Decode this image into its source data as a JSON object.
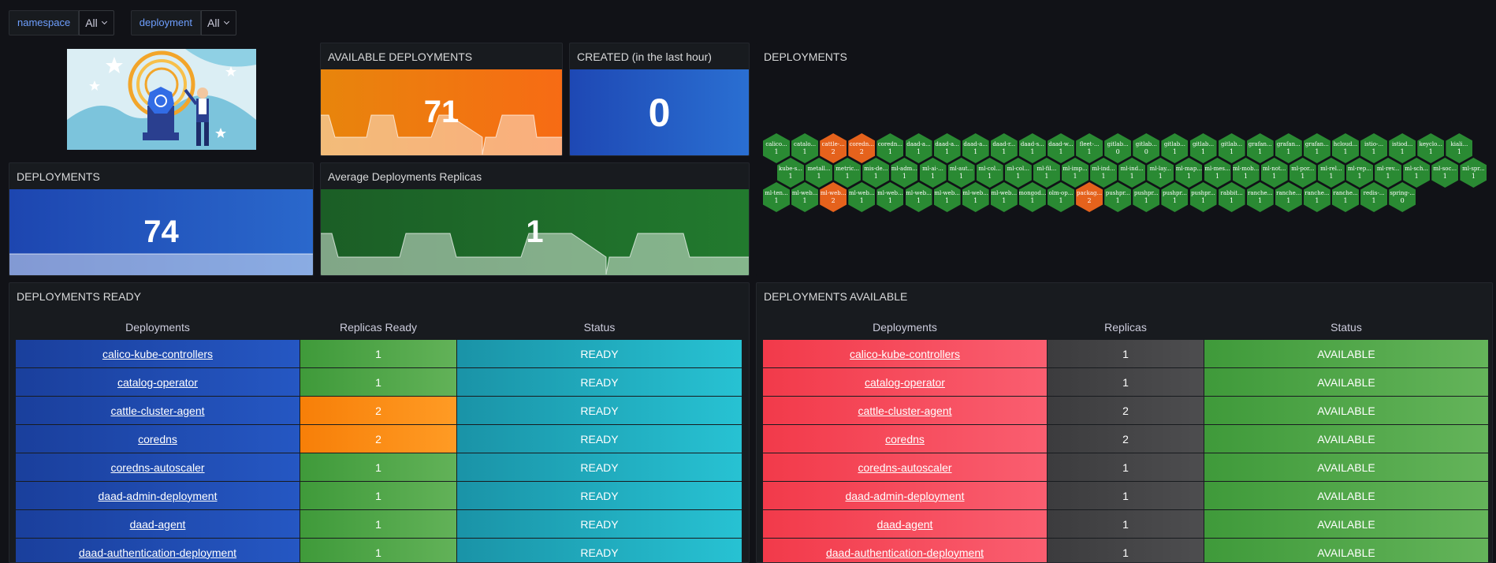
{
  "variables": [
    {
      "label": "namespace",
      "value": "All"
    },
    {
      "label": "deployment",
      "value": "All"
    }
  ],
  "panels": {
    "available_deployments": {
      "title": "AVAILABLE DEPLOYMENTS",
      "value": "71"
    },
    "created_last_hour": {
      "title": "CREATED (in the last hour)",
      "value": "0"
    },
    "deployments_count": {
      "title": "DEPLOYMENTS",
      "value": "74"
    },
    "avg_replicas": {
      "title": "Average Deployments Replicas",
      "value": "1"
    },
    "hex_panel": {
      "title": "DEPLOYMENTS"
    }
  },
  "colors": {
    "orange": "#f57110",
    "blue": "#1f5fc6",
    "green": "#1d7a2b",
    "hex_green": "#2a8a33",
    "hex_orange": "#e5621c",
    "ready_green": "#56a64b",
    "ready_orange": "#ff8c10",
    "status_teal": "#21a7b8",
    "red": "#f2495c",
    "gray": "#4a4a4c"
  },
  "hexagons": {
    "row1": [
      {
        "name": "calico...",
        "value": "1"
      },
      {
        "name": "catalo...",
        "value": "1"
      },
      {
        "name": "cattle-...",
        "value": "2"
      },
      {
        "name": "coredn...",
        "value": "2"
      },
      {
        "name": "coredn...",
        "value": "1"
      },
      {
        "name": "daad-a...",
        "value": "1"
      },
      {
        "name": "daad-a...",
        "value": "1"
      },
      {
        "name": "daad-a...",
        "value": "1"
      },
      {
        "name": "daad-r...",
        "value": "1"
      },
      {
        "name": "daad-s...",
        "value": "1"
      },
      {
        "name": "daad-w...",
        "value": "1"
      },
      {
        "name": "fleet-...",
        "value": "1"
      },
      {
        "name": "gitlab...",
        "value": "0"
      },
      {
        "name": "gitlab...",
        "value": "0"
      },
      {
        "name": "gitlab...",
        "value": "1"
      },
      {
        "name": "gitlab...",
        "value": "1"
      },
      {
        "name": "gitlab...",
        "value": "1"
      },
      {
        "name": "grafan...",
        "value": "1"
      },
      {
        "name": "grafan...",
        "value": "1"
      },
      {
        "name": "grafan...",
        "value": "1"
      },
      {
        "name": "hcloud...",
        "value": "1"
      },
      {
        "name": "istio-...",
        "value": "1"
      },
      {
        "name": "istiod...",
        "value": "1"
      },
      {
        "name": "keyclo...",
        "value": "1"
      },
      {
        "name": "kiali...",
        "value": "1"
      }
    ],
    "row2": [
      {
        "name": "kube-s...",
        "value": "1"
      },
      {
        "name": "metall...",
        "value": "1"
      },
      {
        "name": "metric...",
        "value": "1"
      },
      {
        "name": "mis-de...",
        "value": "1"
      },
      {
        "name": "ml-adm...",
        "value": "1"
      },
      {
        "name": "ml-ai-...",
        "value": "1"
      },
      {
        "name": "ml-aut...",
        "value": "1"
      },
      {
        "name": "ml-col...",
        "value": "1"
      },
      {
        "name": "ml-col...",
        "value": "1"
      },
      {
        "name": "ml-fil...",
        "value": "1"
      },
      {
        "name": "ml-imp...",
        "value": "1"
      },
      {
        "name": "ml-ind...",
        "value": "1"
      },
      {
        "name": "ml-ind...",
        "value": "1"
      },
      {
        "name": "ml-lay...",
        "value": "1"
      },
      {
        "name": "ml-map...",
        "value": "1"
      },
      {
        "name": "ml-mes...",
        "value": "1"
      },
      {
        "name": "ml-mob...",
        "value": "1"
      },
      {
        "name": "ml-not...",
        "value": "1"
      },
      {
        "name": "ml-por...",
        "value": "1"
      },
      {
        "name": "ml-rel...",
        "value": "1"
      },
      {
        "name": "ml-rep...",
        "value": "1"
      },
      {
        "name": "ml-rev...",
        "value": "1"
      },
      {
        "name": "ml-sch...",
        "value": "1"
      },
      {
        "name": "ml-soc...",
        "value": "1"
      },
      {
        "name": "ml-spr...",
        "value": "1"
      }
    ],
    "row3": [
      {
        "name": "ml-ten...",
        "value": "1"
      },
      {
        "name": "ml-web...",
        "value": "1"
      },
      {
        "name": "ml-web...",
        "value": "2"
      },
      {
        "name": "ml-web...",
        "value": "1"
      },
      {
        "name": "ml-web...",
        "value": "1"
      },
      {
        "name": "ml-web...",
        "value": "1"
      },
      {
        "name": "ml-web...",
        "value": "1"
      },
      {
        "name": "ml-web...",
        "value": "1"
      },
      {
        "name": "ml-web...",
        "value": "1"
      },
      {
        "name": "mongod...",
        "value": "1"
      },
      {
        "name": "olm-op...",
        "value": "1"
      },
      {
        "name": "packag...",
        "value": "2"
      },
      {
        "name": "pushpr...",
        "value": "1"
      },
      {
        "name": "pushpr...",
        "value": "1"
      },
      {
        "name": "pushpr...",
        "value": "1"
      },
      {
        "name": "pushpr...",
        "value": "1"
      },
      {
        "name": "rabbit...",
        "value": "1"
      },
      {
        "name": "ranche...",
        "value": "1"
      },
      {
        "name": "ranche...",
        "value": "1"
      },
      {
        "name": "ranche...",
        "value": "1"
      },
      {
        "name": "ranche...",
        "value": "1"
      },
      {
        "name": "redis-...",
        "value": "1"
      },
      {
        "name": "spring-...",
        "value": "0"
      }
    ]
  },
  "ready_table": {
    "title": "DEPLOYMENTS READY",
    "headers": [
      "Deployments",
      "Replicas Ready",
      "Status"
    ],
    "rows": [
      {
        "name": "calico-kube-controllers",
        "replicas": "1",
        "status": "READY"
      },
      {
        "name": "catalog-operator",
        "replicas": "1",
        "status": "READY"
      },
      {
        "name": "cattle-cluster-agent",
        "replicas": "2",
        "status": "READY"
      },
      {
        "name": "coredns",
        "replicas": "2",
        "status": "READY"
      },
      {
        "name": "coredns-autoscaler",
        "replicas": "1",
        "status": "READY"
      },
      {
        "name": "daad-admin-deployment",
        "replicas": "1",
        "status": "READY"
      },
      {
        "name": "daad-agent",
        "replicas": "1",
        "status": "READY"
      },
      {
        "name": "daad-authentication-deployment",
        "replicas": "1",
        "status": "READY"
      }
    ]
  },
  "available_table": {
    "title": "DEPLOYMENTS AVAILABLE",
    "headers": [
      "Deployments",
      "Replicas",
      "Status"
    ],
    "rows": [
      {
        "name": "calico-kube-controllers",
        "replicas": "1",
        "status": "AVAILABLE"
      },
      {
        "name": "catalog-operator",
        "replicas": "1",
        "status": "AVAILABLE"
      },
      {
        "name": "cattle-cluster-agent",
        "replicas": "2",
        "status": "AVAILABLE"
      },
      {
        "name": "coredns",
        "replicas": "2",
        "status": "AVAILABLE"
      },
      {
        "name": "coredns-autoscaler",
        "replicas": "1",
        "status": "AVAILABLE"
      },
      {
        "name": "daad-admin-deployment",
        "replicas": "1",
        "status": "AVAILABLE"
      },
      {
        "name": "daad-agent",
        "replicas": "1",
        "status": "AVAILABLE"
      },
      {
        "name": "daad-authentication-deployment",
        "replicas": "1",
        "status": "AVAILABLE"
      }
    ]
  }
}
